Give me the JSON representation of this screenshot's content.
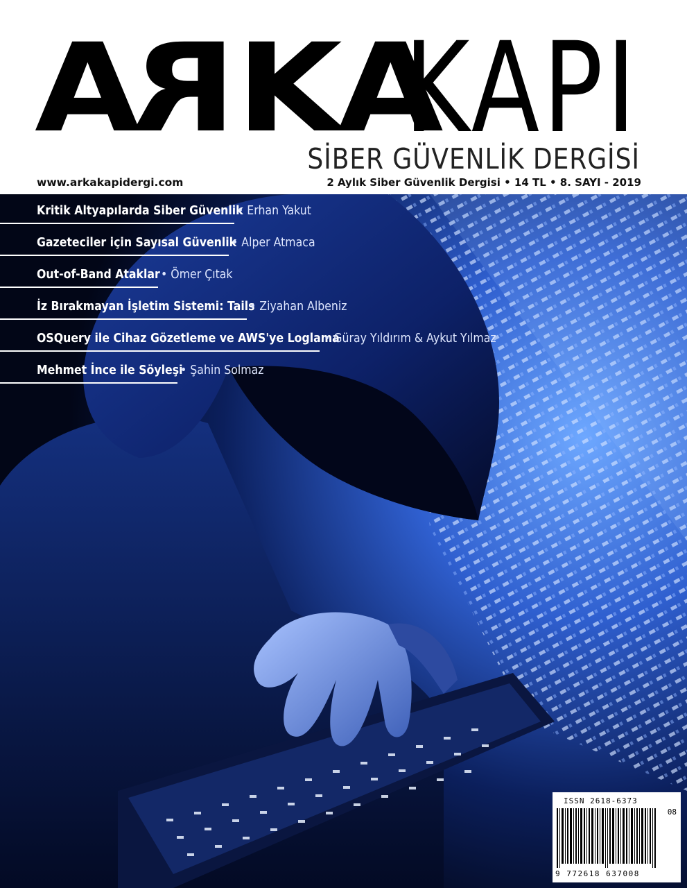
{
  "masthead": {
    "logo_bold_part1": "A",
    "logo_bold_mirrored": "R",
    "logo_bold_part2": "KA",
    "logo_light": "KAPI",
    "subtitle": "SİBER GÜVENLİK DERGİSİ",
    "website": "www.arkakapidergi.com",
    "issue_info": "2 Aylık Siber Güvenlik Dergisi • 14 TL • 8. SAYI - 2019"
  },
  "toc": [
    {
      "title": "Kritik Altyapılarda Siber Güvenlik",
      "author": "• Erhan Yakut"
    },
    {
      "title": "Gazeteciler için Sayısal Güvenlik",
      "author": "• Alper Atmaca"
    },
    {
      "title": "Out-of-Band Ataklar",
      "author": "• Ömer Çıtak"
    },
    {
      "title": "İz Bırakmayan İşletim Sistemi: Tails",
      "author": "• Ziyahan Albeniz"
    },
    {
      "title": "OSQuery ile Cihaz Gözetleme ve AWS'ye Loglama",
      "author": "• Güray Yıldırım & Aykut Yılmaz"
    },
    {
      "title": "Mehmet İnce ile Söyleşi",
      "author": "• Şahin Solmaz"
    }
  ],
  "barcode": {
    "issn": "ISSN 2618-6373",
    "issue_code": "08",
    "digits": "9 772618 637008"
  },
  "colors": {
    "cover_dark": "#020617",
    "cover_blue": "#1e3a8a",
    "glow": "#7fb0ff"
  }
}
